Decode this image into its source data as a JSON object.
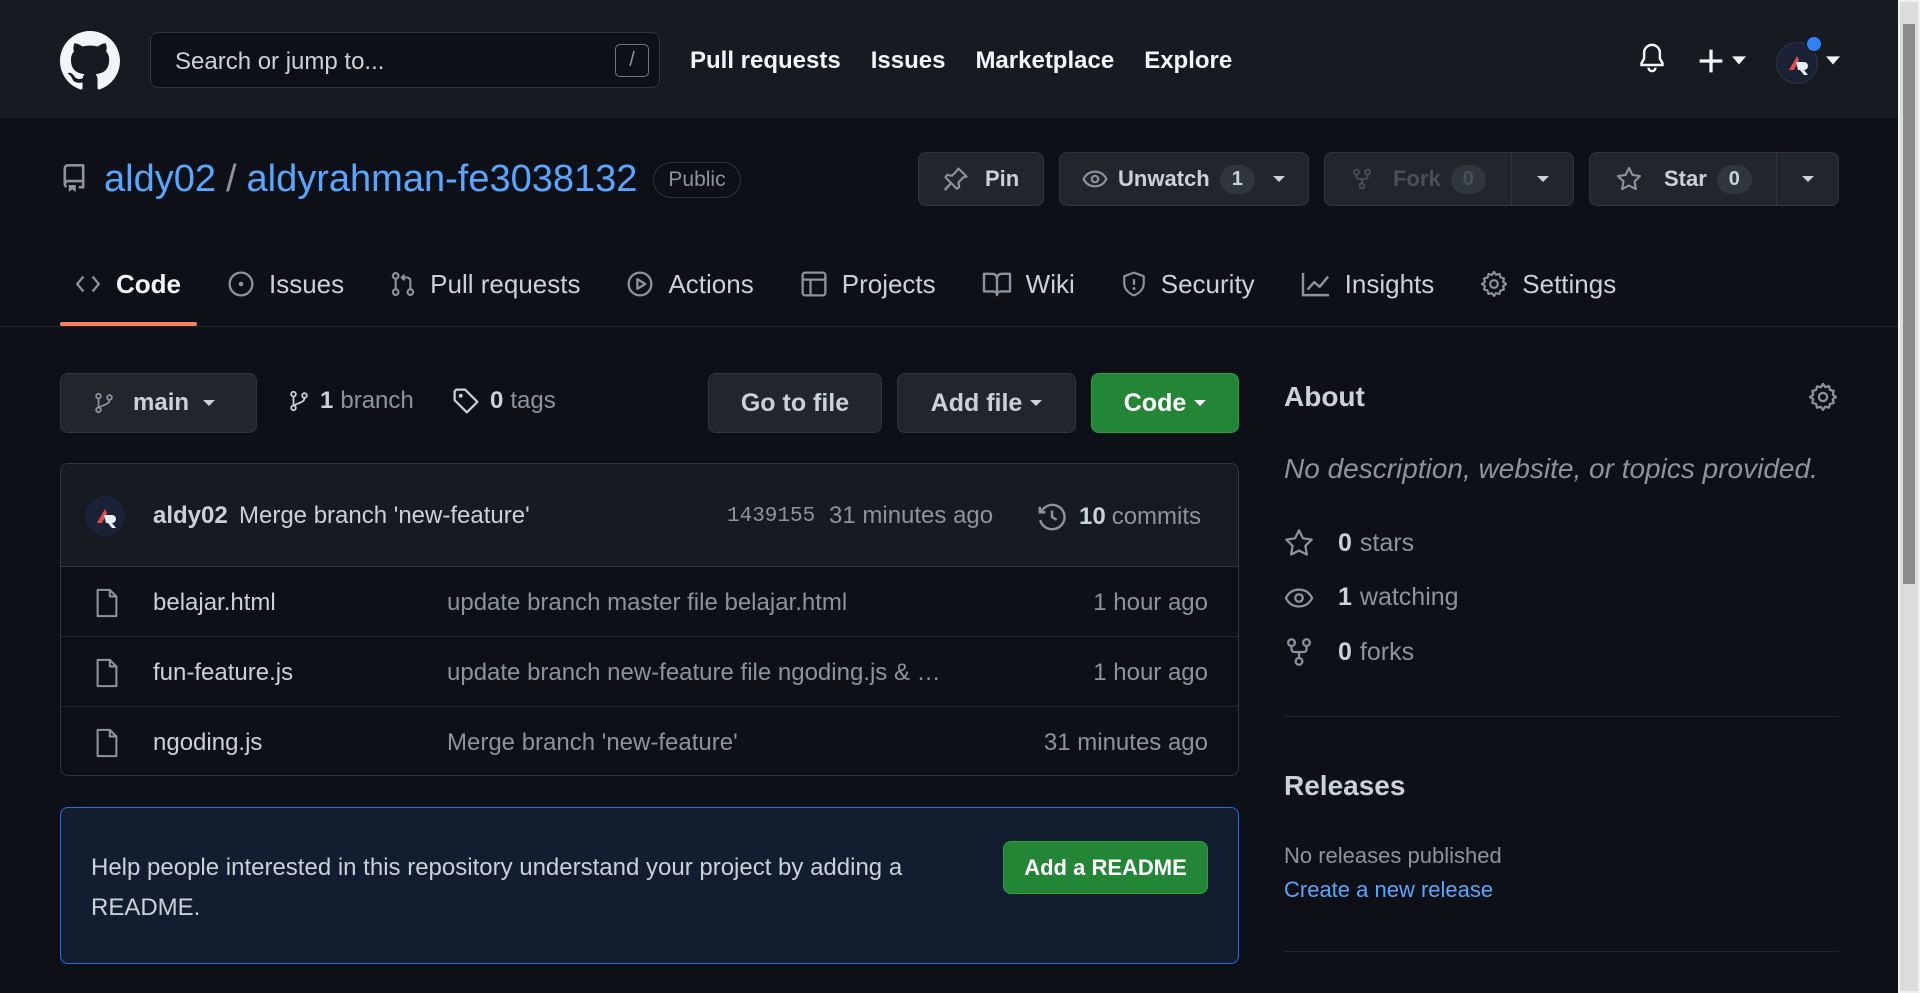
{
  "header": {
    "search_placeholder": "Search or jump to...",
    "search_shortcut": "/",
    "nav": [
      "Pull requests",
      "Issues",
      "Marketplace",
      "Explore"
    ]
  },
  "repo": {
    "owner": "aldy02",
    "separator": "/",
    "name": "aldyrahman-fe3038132",
    "visibility": "Public",
    "pin_label": "Pin",
    "unwatch_label": "Unwatch",
    "unwatch_count": "1",
    "fork_label": "Fork",
    "fork_count": "0",
    "star_label": "Star",
    "star_count": "0"
  },
  "tabs": [
    {
      "label": "Code",
      "icon": "code-icon",
      "active": true
    },
    {
      "label": "Issues",
      "icon": "issue-icon"
    },
    {
      "label": "Pull requests",
      "icon": "pull-request-icon"
    },
    {
      "label": "Actions",
      "icon": "play-icon"
    },
    {
      "label": "Projects",
      "icon": "table-icon"
    },
    {
      "label": "Wiki",
      "icon": "book-icon"
    },
    {
      "label": "Security",
      "icon": "shield-icon"
    },
    {
      "label": "Insights",
      "icon": "graph-icon"
    },
    {
      "label": "Settings",
      "icon": "gear-icon"
    }
  ],
  "filenav": {
    "branch": "main",
    "branch_count": "1",
    "branch_label": "branch",
    "tag_count": "0",
    "tag_label": "tags",
    "go_to_file": "Go to file",
    "add_file": "Add file",
    "code": "Code"
  },
  "latest_commit": {
    "author": "aldy02",
    "message": "Merge branch 'new-feature'",
    "sha": "1439155",
    "ago": "31 minutes ago",
    "commit_count": "10",
    "commits_label": "commits"
  },
  "files": [
    {
      "name": "belajar.html",
      "message": "update branch master file belajar.html",
      "age": "1 hour ago"
    },
    {
      "name": "fun-feature.js",
      "message": "update branch new-feature file ngoding.js & …",
      "age": "1 hour ago"
    },
    {
      "name": "ngoding.js",
      "message": "Merge branch 'new-feature'",
      "age": "31 minutes ago"
    }
  ],
  "readme_prompt": {
    "text": "Help people interested in this repository understand your project by adding a README.",
    "button": "Add a README"
  },
  "about": {
    "heading": "About",
    "description": "No description, website, or topics provided.",
    "stars_count": "0",
    "stars_label": "stars",
    "watching_count": "1",
    "watching_label": "watching",
    "forks_count": "0",
    "forks_label": "forks"
  },
  "releases": {
    "heading": "Releases",
    "none_text": "No releases published",
    "create_link": "Create a new release"
  },
  "colors": {
    "background": "#0d1117",
    "header": "#161b22",
    "link": "#58a6ff",
    "green_button": "#238636",
    "active_tab_underline": "#f78166"
  }
}
